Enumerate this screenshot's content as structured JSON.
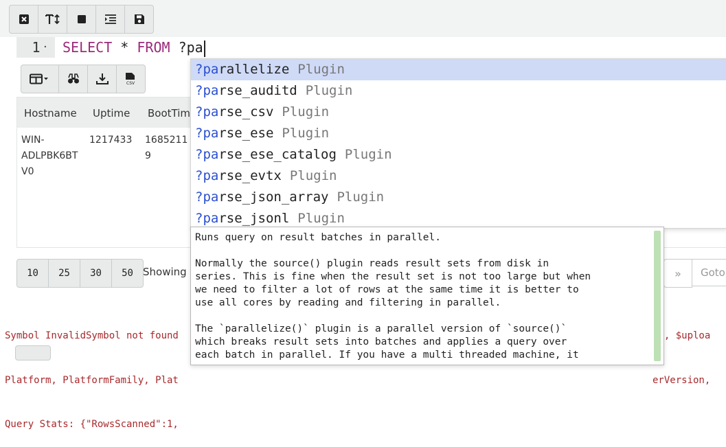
{
  "editor_toolbar": {
    "buttons": [
      {
        "icon": "close-square-icon"
      },
      {
        "icon": "font-size-icon"
      },
      {
        "icon": "stop-square-icon"
      },
      {
        "icon": "indent-icon"
      },
      {
        "icon": "save-icon"
      }
    ]
  },
  "editor": {
    "line_number": "1",
    "line_marker": "·",
    "keyword_select": "SELECT",
    "star": " * ",
    "keyword_from": "FROM",
    "typed_text": " ?pa"
  },
  "table_toolbar": {
    "buttons": [
      {
        "icon": "column-layout-dropdown-icon"
      },
      {
        "icon": "binoculars-icon"
      },
      {
        "icon": "download-icon"
      },
      {
        "icon": "csv-file-icon"
      }
    ]
  },
  "table": {
    "columns": [
      "Hostname",
      "Uptime",
      "BootTim"
    ],
    "row": {
      "hostname": "WIN-\nADLPBK6BT\nV0",
      "uptime": "1217433",
      "boottime": "1685211\n9"
    }
  },
  "pager": {
    "page_sizes": [
      "10",
      "25",
      "30",
      "50"
    ],
    "showing_label": "Showing",
    "next_label": "»",
    "goto_placeholder": "Goto"
  },
  "errors": {
    "left_lines": [
      "Symbol InvalidSymbol not found",
      "Platform, PlatformFamily, Plat",
      "Query Stats: {\"RowsScanned\":1,"
    ],
    "right_lines": [
      "cl, $uploa",
      "erVersion,",
      ""
    ]
  },
  "autocomplete": {
    "match_prefix": "?pa",
    "items": [
      {
        "rest": "rallelize",
        "type": "Plugin",
        "selected": true
      },
      {
        "rest": "rse_auditd",
        "type": "Plugin",
        "selected": false
      },
      {
        "rest": "rse_csv",
        "type": "Plugin",
        "selected": false
      },
      {
        "rest": "rse_ese",
        "type": "Plugin",
        "selected": false
      },
      {
        "rest": "rse_ese_catalog",
        "type": "Plugin",
        "selected": false
      },
      {
        "rest": "rse_evtx",
        "type": "Plugin",
        "selected": false
      },
      {
        "rest": "rse_json_array",
        "type": "Plugin",
        "selected": false
      },
      {
        "rest": "rse_jsonl",
        "type": "Plugin",
        "selected": false
      }
    ]
  },
  "doc": {
    "text": "Runs query on result batches in parallel.\n\nNormally the source() plugin reads result sets from disk in\nseries. This is fine when the result set is not too large but when\nwe need to filter a lot of rows at the same time it is better to\nuse all cores by reading and filtering in parallel.\n\nThe `parallelize()` plugin is a parallel version of `source()`\nwhich breaks result sets into batches and applies a query over\neach batch in parallel. If you have a multi threaded machine, it"
  }
}
